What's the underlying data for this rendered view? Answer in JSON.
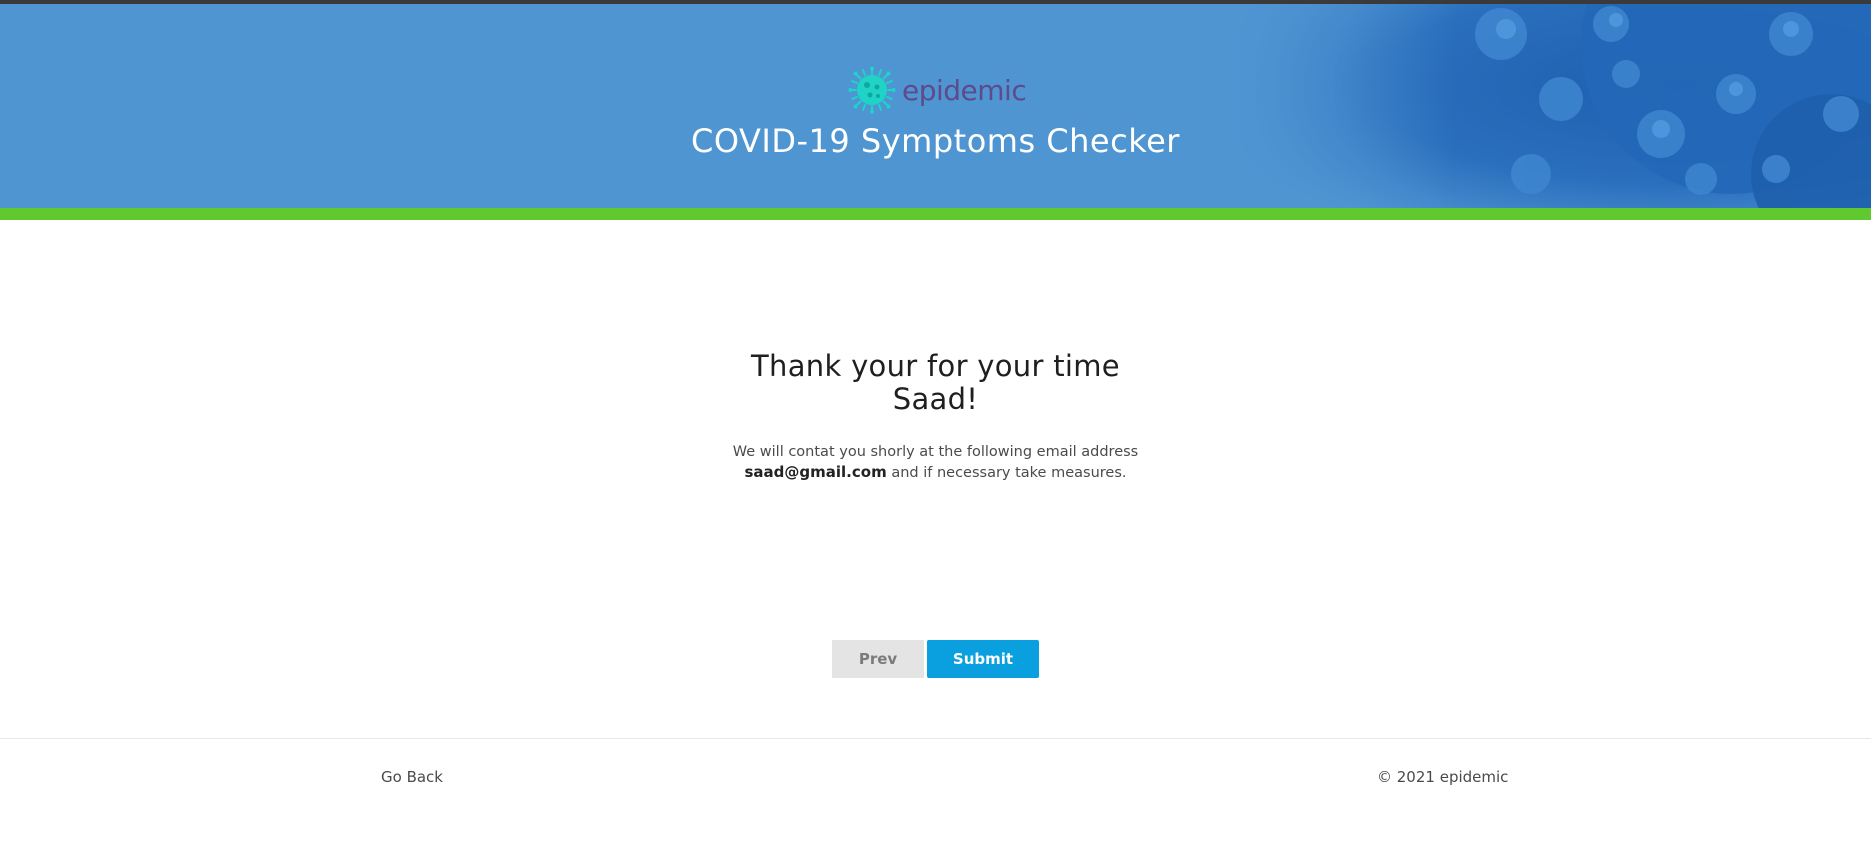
{
  "header": {
    "brand_name": "epidemic",
    "title": "COVID-19 Symptoms Checker",
    "colors": {
      "background": "#4f95d2",
      "accent_bar": "#5fc92f",
      "brand": "#5e4a8c",
      "logo": "#1fd3c7"
    },
    "logo_icon": "virus-logo-icon"
  },
  "main": {
    "heading_line1": "Thank your for your time",
    "heading_line2": "Saad!",
    "message_line1": "We will contat you shorly at the following email address",
    "email": "saad@gmail.com",
    "message_line2_suffix": " and if necessary take measures."
  },
  "actions": {
    "prev_label": "Prev",
    "submit_label": "Submit",
    "submit_color": "#0aa0e0"
  },
  "footer": {
    "go_back_label": "Go Back",
    "copyright": "© 2021 epidemic"
  }
}
